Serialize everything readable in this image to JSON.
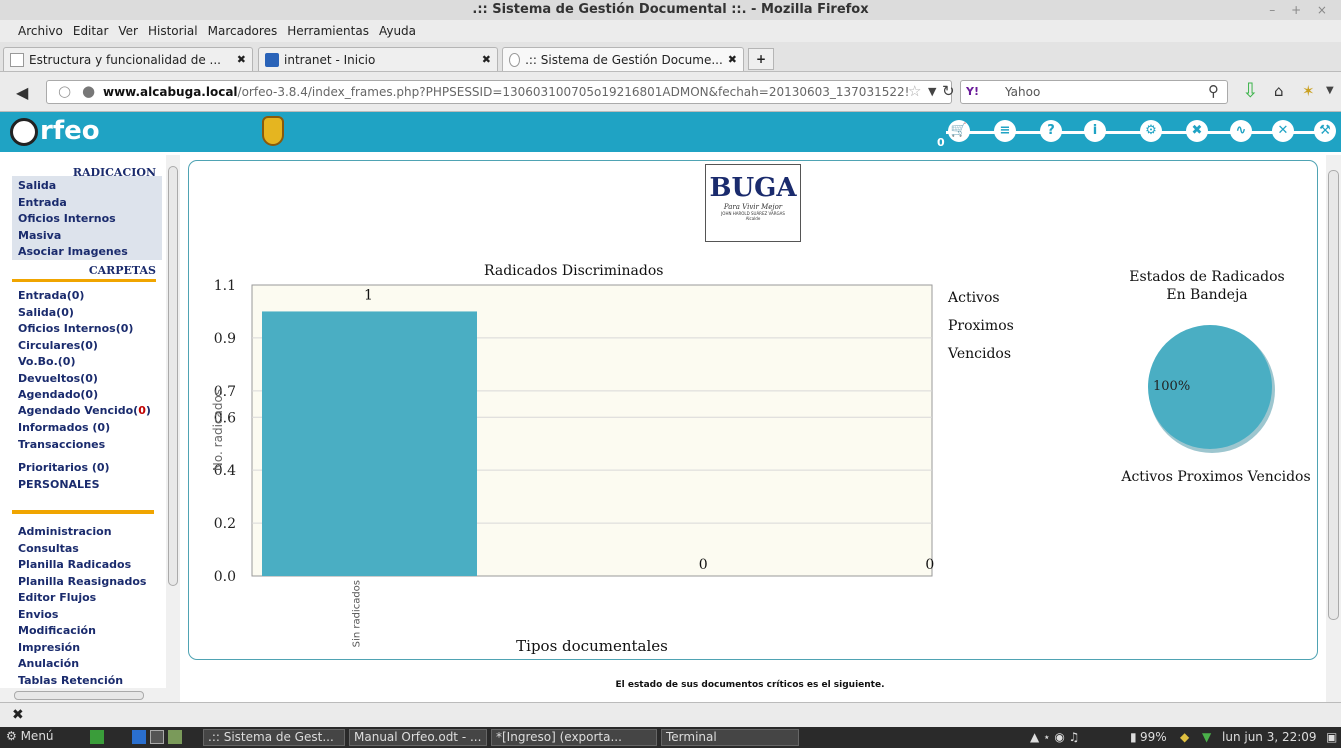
{
  "window": {
    "title": ".:: Sistema de Gestión Documental ::. - Mozilla Firefox",
    "controls": "– + ×"
  },
  "menu": [
    "Archivo",
    "Editar",
    "Ver",
    "Historial",
    "Marcadores",
    "Herramientas",
    "Ayuda"
  ],
  "tabs": [
    {
      "label": "Estructura y funcionalidad de ...",
      "close": "✖"
    },
    {
      "label": "intranet - Inicio",
      "close": "✖"
    },
    {
      "label": ".:: Sistema de Gestión Docume...",
      "close": "✖"
    }
  ],
  "newtab": "+",
  "nav": {
    "url_host": "www.alcabuga.local",
    "url_path": "/orfeo-3.8.4/index_frames.php?PHPSESSID=130603100705o19216801ADMON&fechah=20130603_137031522!",
    "search_placeholder": "Yahoo",
    "search_engine": "Y!"
  },
  "app": {
    "logo_text": "rfeo",
    "tools_count": "0",
    "tool_icons": [
      "cart-icon",
      "document-icon",
      "help-icon",
      "info-icon",
      "fingerprint-icon",
      "tools-icon",
      "activity-icon",
      "close-icon",
      "wrench-icon"
    ]
  },
  "sidebar": {
    "radicacion_title": "RADICACION",
    "radicacion_items": [
      "Salida",
      "Entrada",
      "Oficios Internos",
      "Masiva",
      "Asociar Imagenes"
    ],
    "carpetas_title": "CARPETAS",
    "carpetas_items": [
      "Entrada(0)",
      "Salida(0)",
      "Oficios Internos(0)",
      "Circulares(0)",
      "Vo.Bo.(0)",
      "Devueltos(0)",
      "Agendado(0)"
    ],
    "agendado_vencido_label": "Agendado Vencido(",
    "agendado_vencido_count": "0",
    "agendado_vencido_close": ")",
    "more_items": [
      "Informados (0)",
      "Transacciones"
    ],
    "personal_items": [
      "Prioritarios (0)",
      "PERSONALES"
    ],
    "admin_items": [
      "Administracion",
      "Consultas",
      "Planilla Radicados",
      "Planilla Reasignados",
      "Editor Flujos",
      "Envios",
      "Modificación",
      "Impresión",
      "Anulación",
      "Tablas Retención"
    ]
  },
  "logo_box": {
    "brand": "BUGA",
    "tagline": "Para Vivir Mejor",
    "mayor": "JOHN HAROLD SUÁREZ VARGAS",
    "role": "Alcalde"
  },
  "footnote": "El estado de sus documentos críticos es el siguiente.",
  "statusbar": {
    "close": "✖"
  },
  "taskbar": {
    "menu": "Menú",
    "tasks": [
      ".:: Sistema de Gest...",
      "Manual Orfeo.odt - ...",
      "*[Ingreso] (exporta...",
      "Terminal"
    ],
    "battery": "99%",
    "clock": "lun jun  3, 22:09"
  },
  "chart_data": [
    {
      "type": "bar",
      "title": "Radicados Discriminados",
      "xlabel": "Tipos documentales",
      "ylabel": "No. radicados",
      "categories": [
        "Sin radicados",
        "",
        ""
      ],
      "values": [
        1,
        0,
        0
      ],
      "data_labels": [
        "1",
        "0",
        "0"
      ],
      "ylim": [
        0,
        1.1
      ],
      "yticks": [
        "1.1",
        "0.9",
        "0.7",
        "0.6",
        "0.4",
        "0.2",
        "0.0"
      ],
      "ytick_values": [
        1.1,
        0.9,
        0.7,
        0.6,
        0.4,
        0.2,
        0.0
      ],
      "legend": [
        "Activos",
        "Proximos",
        "Vencidos"
      ],
      "legend_position": "right",
      "bar_color": "#4aaec3",
      "plot_bg": "#fcfbf1",
      "grid": true
    },
    {
      "type": "pie",
      "title": "Estados de Radicados En Bandeja",
      "title_lines": [
        "Estados de Radicados",
        "En Bandeja"
      ],
      "slices": [
        {
          "label": "Activos",
          "value": 100,
          "color": "#4aaec3"
        }
      ],
      "slice_label": "100%",
      "legend": [
        "Activos",
        "Proximos",
        "Vencidos"
      ],
      "legend_line": "Activos  Proximos  Vencidos"
    }
  ]
}
